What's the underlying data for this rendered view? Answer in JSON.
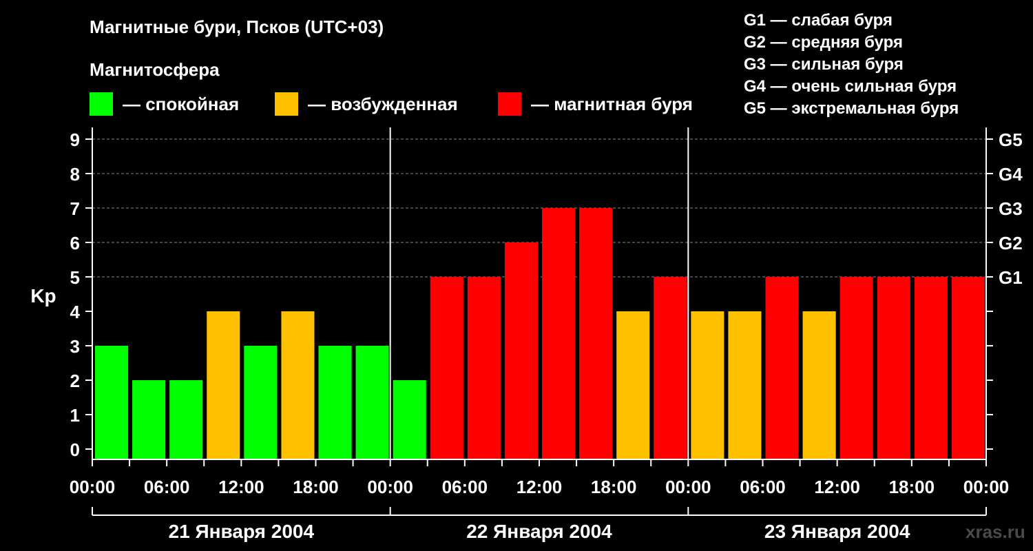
{
  "chart_data": {
    "type": "bar",
    "title": "Магнитные бури, Псков (UTC+03)",
    "subtitle": "Магнитосфера",
    "ylabel": "Kp",
    "ylim": [
      0,
      9
    ],
    "y_ticks": [
      "0",
      "1",
      "2",
      "3",
      "4",
      "5",
      "6",
      "7",
      "8",
      "9"
    ],
    "right_ticks": [
      {
        "value": 5,
        "label": "G1"
      },
      {
        "value": 6,
        "label": "G2"
      },
      {
        "value": 7,
        "label": "G3"
      },
      {
        "value": 8,
        "label": "G4"
      },
      {
        "value": 9,
        "label": "G5"
      }
    ],
    "x_tick_labels": [
      "00:00",
      "06:00",
      "12:00",
      "18:00",
      "00:00",
      "06:00",
      "12:00",
      "18:00",
      "00:00",
      "06:00",
      "12:00",
      "18:00",
      "00:00"
    ],
    "days": [
      "21 Января 2004",
      "22 Января 2004",
      "23 Января 2004"
    ],
    "interval_hours": 3,
    "values": [
      3,
      2,
      2,
      4,
      3,
      4,
      3,
      3,
      2,
      5,
      5,
      6,
      7,
      7,
      4,
      5,
      4,
      4,
      5,
      4,
      5,
      5,
      5,
      5
    ],
    "legend": [
      {
        "label": "— спокойная",
        "color": "#00ff00"
      },
      {
        "label": "— возбужденная",
        "color": "#ffc000"
      },
      {
        "label": "— магнитная буря",
        "color": "#ff0000"
      }
    ],
    "color_rule": {
      "calm_max": 3,
      "unsettled": 4,
      "storm_min": 5
    },
    "g_scale": [
      "G1 — слабая буря",
      "G2 — средняя буря",
      "G3 — сильная буря",
      "G4 — очень сильная буря",
      "G5 — экстремальная буря"
    ],
    "grid": true
  },
  "watermark": "xras.ru"
}
